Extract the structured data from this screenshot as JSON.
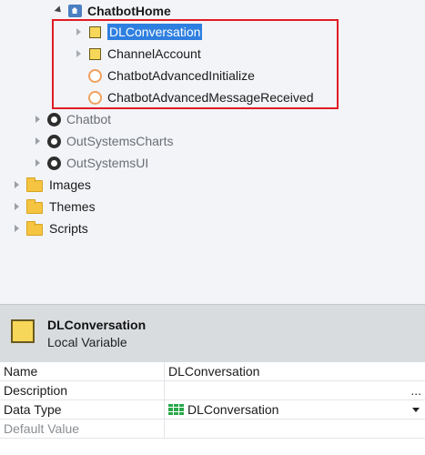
{
  "tree": {
    "root": {
      "label": "ChatbotHome",
      "icon": "webflow-icon"
    },
    "children": [
      {
        "label": "DLConversation",
        "icon": "local-variable-icon",
        "selected": true,
        "expandable": true
      },
      {
        "label": "ChannelAccount",
        "icon": "local-variable-icon",
        "selected": false,
        "expandable": true
      },
      {
        "label": "ChatbotAdvancedInitialize",
        "icon": "client-action-icon",
        "selected": false,
        "expandable": false
      },
      {
        "label": "ChatbotAdvancedMessageReceived",
        "icon": "client-action-icon",
        "selected": false,
        "expandable": false
      }
    ],
    "modules": [
      {
        "label": "Chatbot",
        "icon": "module-icon"
      },
      {
        "label": "OutSystemsCharts",
        "icon": "module-icon"
      },
      {
        "label": "OutSystemsUI",
        "icon": "module-icon"
      }
    ],
    "folders": [
      {
        "label": "Images",
        "icon": "folder-icon"
      },
      {
        "label": "Themes",
        "icon": "folder-icon"
      },
      {
        "label": "Scripts",
        "icon": "folder-icon"
      }
    ]
  },
  "properties": {
    "title": "DLConversation",
    "subtitle": "Local Variable",
    "rows": [
      {
        "name": "Name",
        "value": "DLConversation"
      },
      {
        "name": "Description",
        "value": "",
        "more": "..."
      },
      {
        "name": "Data Type",
        "value": "DLConversation",
        "icon": "record-list-icon"
      },
      {
        "name": "Default Value",
        "value": ""
      }
    ]
  },
  "colors": {
    "selection": "#2f7fe0",
    "highlight_box": "#e01b24",
    "variable_icon": "#f6d75a",
    "action_icon": "#f0a15e",
    "data_type_icon": "#2aa84a"
  }
}
